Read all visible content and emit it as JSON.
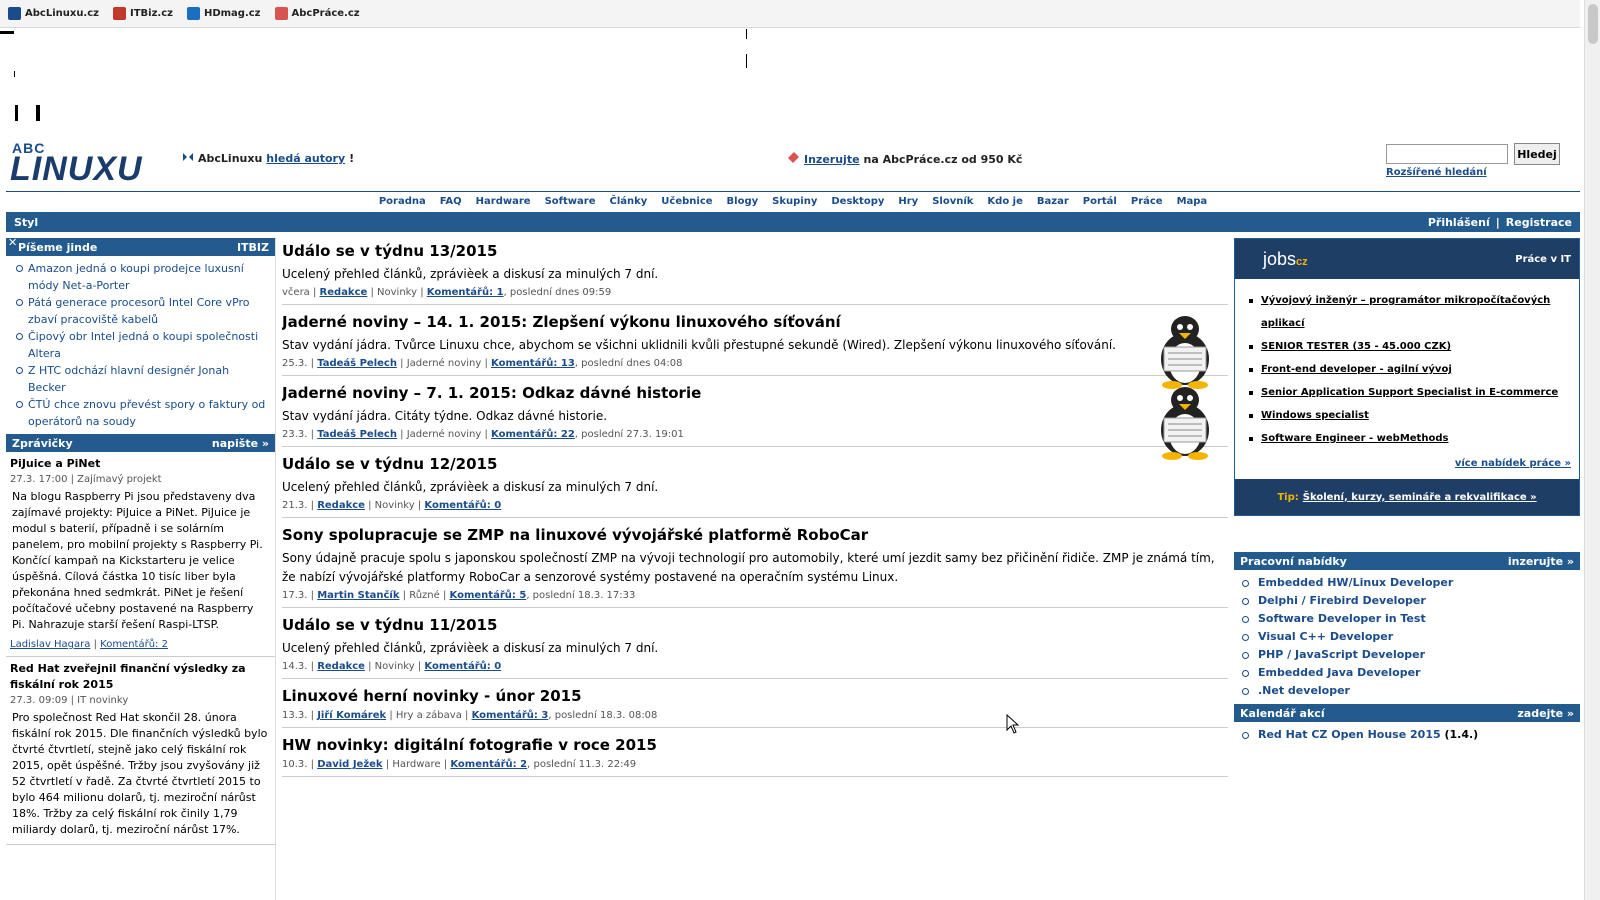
{
  "bookmarks": [
    {
      "label": "AbcLinuxu.cz",
      "color": "#1a4c8c"
    },
    {
      "label": "ITBiz.cz",
      "color": "#c0392b"
    },
    {
      "label": "HDmag.cz",
      "color": "#1a6fc0"
    },
    {
      "label": "AbcPráce.cz",
      "color": "#d9534f"
    }
  ],
  "header": {
    "logo_top": "ABC",
    "logo_main": "LINUXU",
    "promo1_prefix": "AbcLinuxu ",
    "promo1_link": "hledá autory",
    "promo1_suffix": "!",
    "promo2_link": "Inzerujte",
    "promo2_suffix": " na AbcPráce.cz od 950 Kč",
    "search_button": "Hledej",
    "advanced_search": "Rozšířené hledání"
  },
  "nav": [
    "Poradna",
    "FAQ",
    "Hardware",
    "Software",
    "Články",
    "Učebnice",
    "Blogy",
    "Skupiny",
    "Desktopy",
    "Hry",
    "Slovník",
    "Kdo je",
    "Bazar",
    "Portál",
    "Práce",
    "Mapa"
  ],
  "subnav": {
    "left": "Styl",
    "login": "Přihlášení",
    "separator": "|",
    "register": "Registrace"
  },
  "left": {
    "elsewhere": {
      "title": "Píšeme jinde",
      "source": "ITBIZ",
      "items": [
        "Amazon jedná o koupi prodejce luxusní módy Net-a-Porter",
        "Pátá generace procesorů Intel Core vPro zbaví pracoviště kabelů",
        "Čipový obr Intel jedná o koupi společnosti Altera",
        "Z HTC odchází hlavní designér Jonah Becker",
        "ČTÚ chce znovu převést spory o faktury od operátorů na soudy"
      ]
    },
    "news": {
      "title": "Zprávičky",
      "action": "napište »",
      "items": [
        {
          "title": "PiJuice a PiNet",
          "meta": "27.3. 17:00 | Zajímavý projekt",
          "body": "Na blogu Raspberry Pi jsou představeny dva zajímavé projekty: PiJuice a PiNet. PiJuice je modul s baterií, případně i se solárním panelem, pro mobilní projekty s Raspberry Pi. Končící kampaň na Kickstarteru je velice úspěšná. Cílová částka 10 tisíc liber byla překonána hned sedmkrát. PiNet je řešení počítačové učebny postavené na Raspberry Pi. Nahrazuje starší řešení Raspi-LTSP.",
          "author": "Ladislav Hagara",
          "comments": "Komentářů: 2"
        },
        {
          "title": "Red Hat zveřejnil finanční výsledky za fiskální rok 2015",
          "meta": "27.3. 09:09 | IT novinky",
          "body": "Pro společnost Red Hat skončil 28. února fiskální rok 2015. Dle finančních výsledků bylo čtvrté čtvrtletí, stejně jako celý fiskální rok 2015, opět úspěšné. Tržby jsou zvyšovány již 52 čtvrtletí v řadě. Za čtvrté čtvrtletí 2015 to bylo 464 milionu dolarů, tj. meziroční nárůst 18%. Tržby za celý fiskální rok činily 1,79 miliardy dolarů, tj. meziroční nárůst 17%.",
          "author": "",
          "comments": ""
        }
      ]
    }
  },
  "articles": [
    {
      "title": "Událo se v týdnu 13/2015",
      "perex": "Ucelený přehled článků, zprávièek a diskusí za minulých 7 dní.",
      "date": "včera",
      "author": "Redakce",
      "section": "Novinky",
      "comments": "Komentářů: 1",
      "last": ", poslední dnes 09:59",
      "tux": false
    },
    {
      "title": "Jaderné noviny – 14. 1. 2015: Zlepšení výkonu linuxového síťování",
      "perex": "Stav vydání jádra. Tvůrce Linuxu chce, abychom se všichni uklidnili kvůli přestupné sekundě (Wired). Zlepšení výkonu linuxového síťování.",
      "date": "25.3.",
      "author": "Tadeáš Pelech",
      "section": "Jaderné noviny",
      "comments": "Komentářů: 13",
      "last": ", poslední dnes 04:08",
      "tux": true
    },
    {
      "title": "Jaderné noviny – 7. 1. 2015: Odkaz dávné historie",
      "perex": "Stav vydání jádra. Citáty týdne. Odkaz dávné historie.",
      "date": "23.3.",
      "author": "Tadeáš Pelech",
      "section": "Jaderné noviny",
      "comments": "Komentářů: 22",
      "last": ", poslední 27.3. 19:01",
      "tux": true
    },
    {
      "title": "Událo se v týdnu 12/2015",
      "perex": "Ucelený přehled článků, zprávièek a diskusí za minulých 7 dní.",
      "date": "21.3.",
      "author": "Redakce",
      "section": "Novinky",
      "comments": "Komentářů: 0",
      "last": "",
      "tux": false
    },
    {
      "title": "Sony spolupracuje se ZMP na linuxové vývojářské platformě RoboCar",
      "perex": "Sony údajně pracuje spolu s japonskou společností ZMP na vývoji technologií pro automobily, které umí jezdit samy bez přičinění řidiče. ZMP je známá tím, že nabízí vývojářské platformy RoboCar a senzorové systémy postavené na operačním systému Linux.",
      "date": "17.3.",
      "author": "Martin Stančík",
      "section": "Různé",
      "comments": "Komentářů: 5",
      "last": ", poslední 18.3. 17:33",
      "tux": false
    },
    {
      "title": "Událo se v týdnu 11/2015",
      "perex": "Ucelený přehled článků, zprávièek a diskusí za minulých 7 dní.",
      "date": "14.3.",
      "author": "Redakce",
      "section": "Novinky",
      "comments": "Komentářů: 0",
      "last": "",
      "tux": false
    },
    {
      "title": "Linuxové herní novinky - únor 2015",
      "perex": "",
      "date": "13.3.",
      "author": "Jiří Komárek",
      "section": "Hry a zábava",
      "comments": "Komentářů: 3",
      "last": ", poslední 18.3. 08:08",
      "tux": false
    },
    {
      "title": "HW novinky: digitální fotografie v roce 2015",
      "perex": "",
      "date": "10.3.",
      "author": "David Ježek",
      "section": "Hardware",
      "comments": "Komentářů: 2",
      "last": ", poslední 11.3. 22:49",
      "tux": false
    }
  ],
  "jobs": {
    "brand": "jobs",
    "brand_suffix": "cz",
    "tagline": "Práce v IT",
    "items": [
      "Vývojový inženýr – programátor mikropočítačových aplikací",
      "SENIOR TESTER (35 - 45.000 CZK)",
      "Front-end developer - agilní vývoj",
      "Senior Application Support Specialist in E-commerce",
      "Windows specialist",
      "Software Engineer - webMethods"
    ],
    "more": "více nabídek práce »",
    "tip_label": "Tip:",
    "tip_link": "Školení, kurzy, semináře a rekvalifikace »"
  },
  "work_offers": {
    "title": "Pracovní nabídky",
    "action": "inzerujte »",
    "items": [
      "Embedded HW/Linux Developer",
      "Delphi / Firebird Developer",
      "Software Developer in Test",
      "Visual C++ Developer",
      "PHP / JavaScript Developer",
      "Embedded Java Developer",
      ".Net developer"
    ]
  },
  "calendar": {
    "title": "Kalendář akcí",
    "action": "zadejte »",
    "items": [
      {
        "label": "Red Hat CZ Open House 2015",
        "date": " (1.4.)"
      }
    ]
  }
}
